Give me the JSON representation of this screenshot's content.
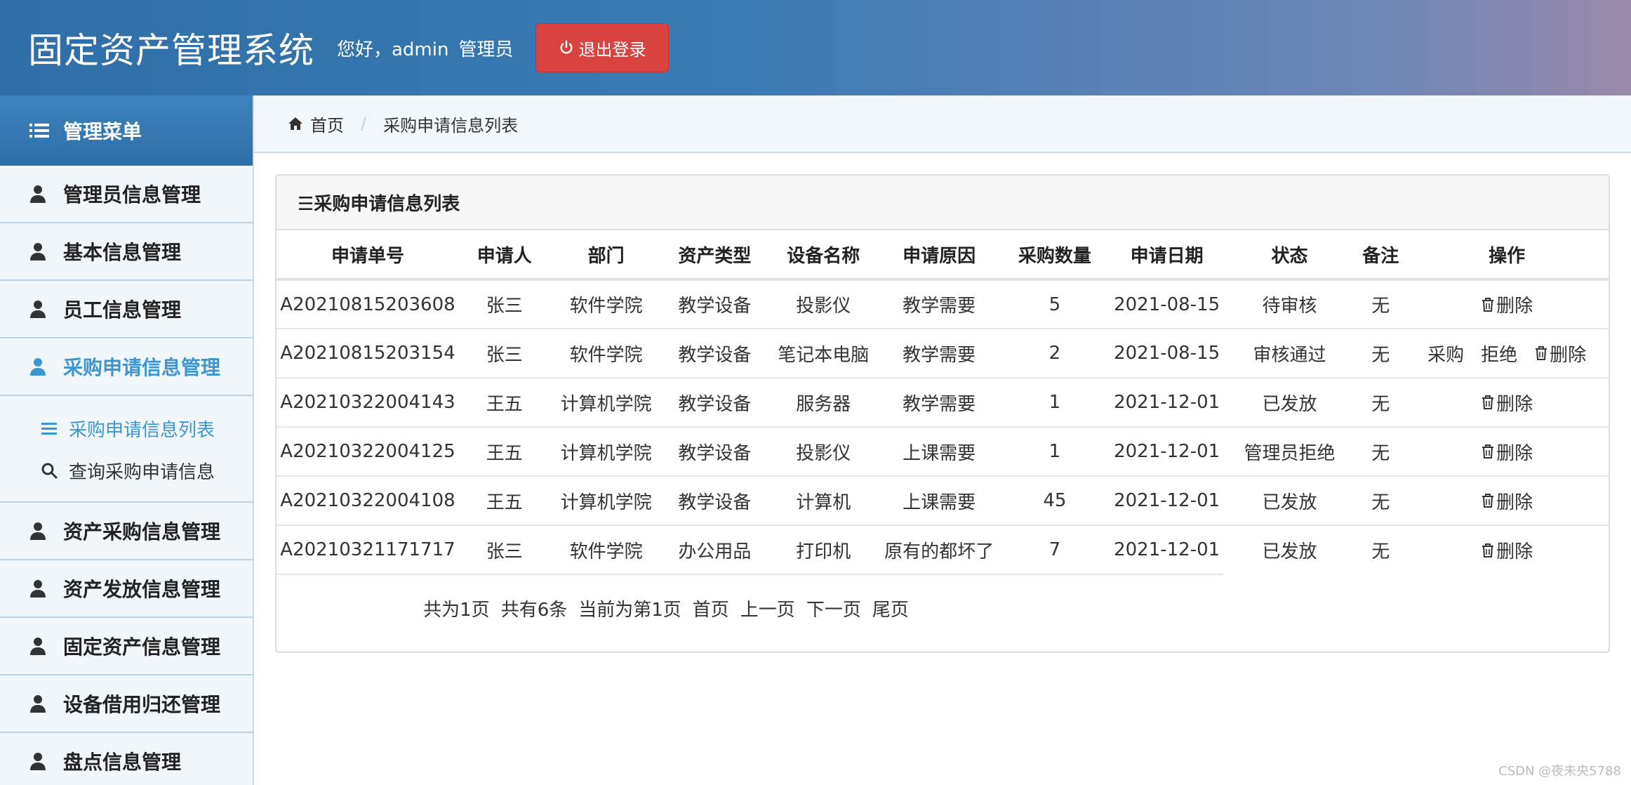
{
  "header": {
    "title": "固定资产管理系统",
    "greeting": "您好，admin",
    "role": "管理员",
    "logout_label": "退出登录"
  },
  "sidebar": {
    "menu_title": "管理菜单",
    "items": [
      {
        "label": "管理员信息管理"
      },
      {
        "label": "基本信息管理"
      },
      {
        "label": "员工信息管理"
      },
      {
        "label": "采购申请信息管理"
      },
      {
        "label": "资产采购信息管理"
      },
      {
        "label": "资产发放信息管理"
      },
      {
        "label": "固定资产信息管理"
      },
      {
        "label": "设备借用归还管理"
      },
      {
        "label": "盘点信息管理"
      }
    ],
    "subitems": [
      {
        "label": "采购申请信息列表"
      },
      {
        "label": "查询采购申请信息"
      }
    ]
  },
  "breadcrumb": {
    "home": "首页",
    "current": "采购申请信息列表"
  },
  "panel": {
    "title": "☰采购申请信息列表"
  },
  "table": {
    "columns": [
      "申请单号",
      "申请人",
      "部门",
      "资产类型",
      "设备名称",
      "申请原因",
      "采购数量",
      "申请日期",
      "状态",
      "备注",
      "操作"
    ],
    "rows": [
      [
        "A20210815203608",
        "张三",
        "软件学院",
        "教学设备",
        "投影仪",
        "教学需要",
        "5",
        "2021-08-15",
        "待审核",
        "无"
      ],
      [
        "A20210815203154",
        "张三",
        "软件学院",
        "教学设备",
        "笔记本电脑",
        "教学需要",
        "2",
        "2021-08-15",
        "审核通过",
        "无"
      ],
      [
        "A20210322004143",
        "王五",
        "计算机学院",
        "教学设备",
        "服务器",
        "教学需要",
        "1",
        "2021-12-01",
        "已发放",
        "无"
      ],
      [
        "A20210322004125",
        "王五",
        "计算机学院",
        "教学设备",
        "投影仪",
        "上课需要",
        "1",
        "2021-12-01",
        "管理员拒绝",
        "无"
      ],
      [
        "A20210322004108",
        "王五",
        "计算机学院",
        "教学设备",
        "计算机",
        "上课需要",
        "45",
        "2021-12-01",
        "已发放",
        "无"
      ],
      [
        "A20210321171717",
        "张三",
        "软件学院",
        "办公用品",
        "打印机",
        "原有的都坏了",
        "7",
        "2021-12-01",
        "已发放",
        "无"
      ]
    ],
    "actions": {
      "delete": "删除",
      "purchase": "采购",
      "reject": "拒绝"
    }
  },
  "pager": {
    "total_pages": "共为1页",
    "total_items": "共有6条",
    "current_page": "当前为第1页",
    "first": "首页",
    "prev": "上一页",
    "next": "下一页",
    "last": "尾页"
  },
  "watermark": "CSDN @夜未央5788"
}
